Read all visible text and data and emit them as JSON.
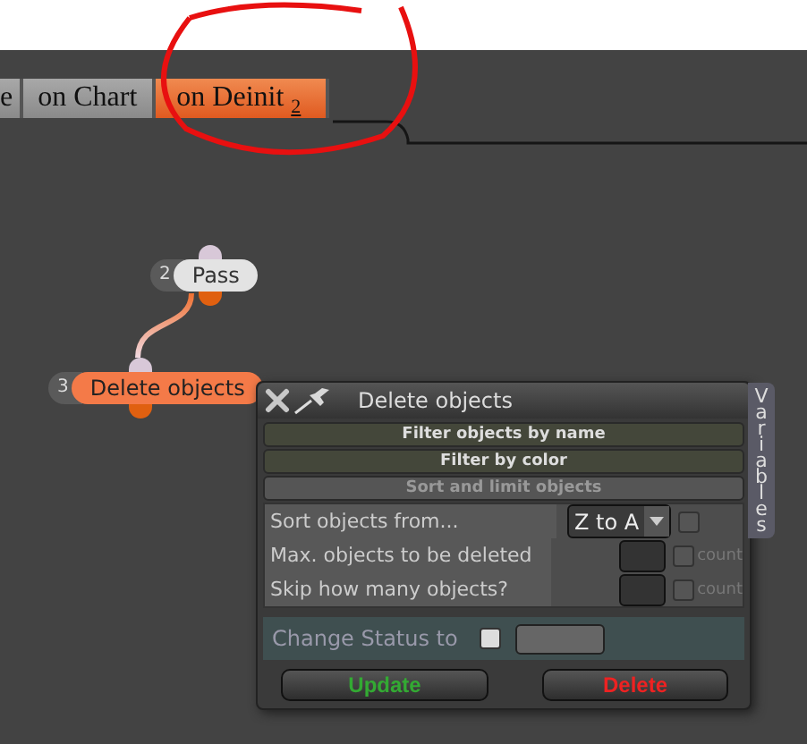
{
  "tabs": [
    {
      "label": "e",
      "selected": false
    },
    {
      "label": "on Chart",
      "selected": false
    },
    {
      "label": "on Deinit",
      "index": "2",
      "selected": true
    }
  ],
  "nodes": [
    {
      "number": "2",
      "label": "Pass",
      "selected": false
    },
    {
      "number": "3",
      "label": "Delete objects",
      "selected": true
    }
  ],
  "dialog": {
    "title": "Delete objects",
    "side_tab": "Variables",
    "sections": [
      {
        "label": "Filter objects by name",
        "expanded": false
      },
      {
        "label": "Filter by color",
        "expanded": false
      },
      {
        "label": "Sort and limit objects",
        "expanded": true
      }
    ],
    "rows": [
      {
        "kind": "dropdown",
        "label": "Sort objects from...",
        "value": "Z to A",
        "checked": false
      },
      {
        "kind": "count",
        "label": "Max. objects to be deleted",
        "hint": "count",
        "checked": false
      },
      {
        "kind": "count",
        "label": "Skip how many objects?",
        "hint": "count",
        "checked": false
      }
    ],
    "status": {
      "label": "Change Status to",
      "checked": false
    },
    "buttons": [
      {
        "label": "Update",
        "kind": "update"
      },
      {
        "label": "Delete",
        "kind": "delete"
      }
    ]
  }
}
